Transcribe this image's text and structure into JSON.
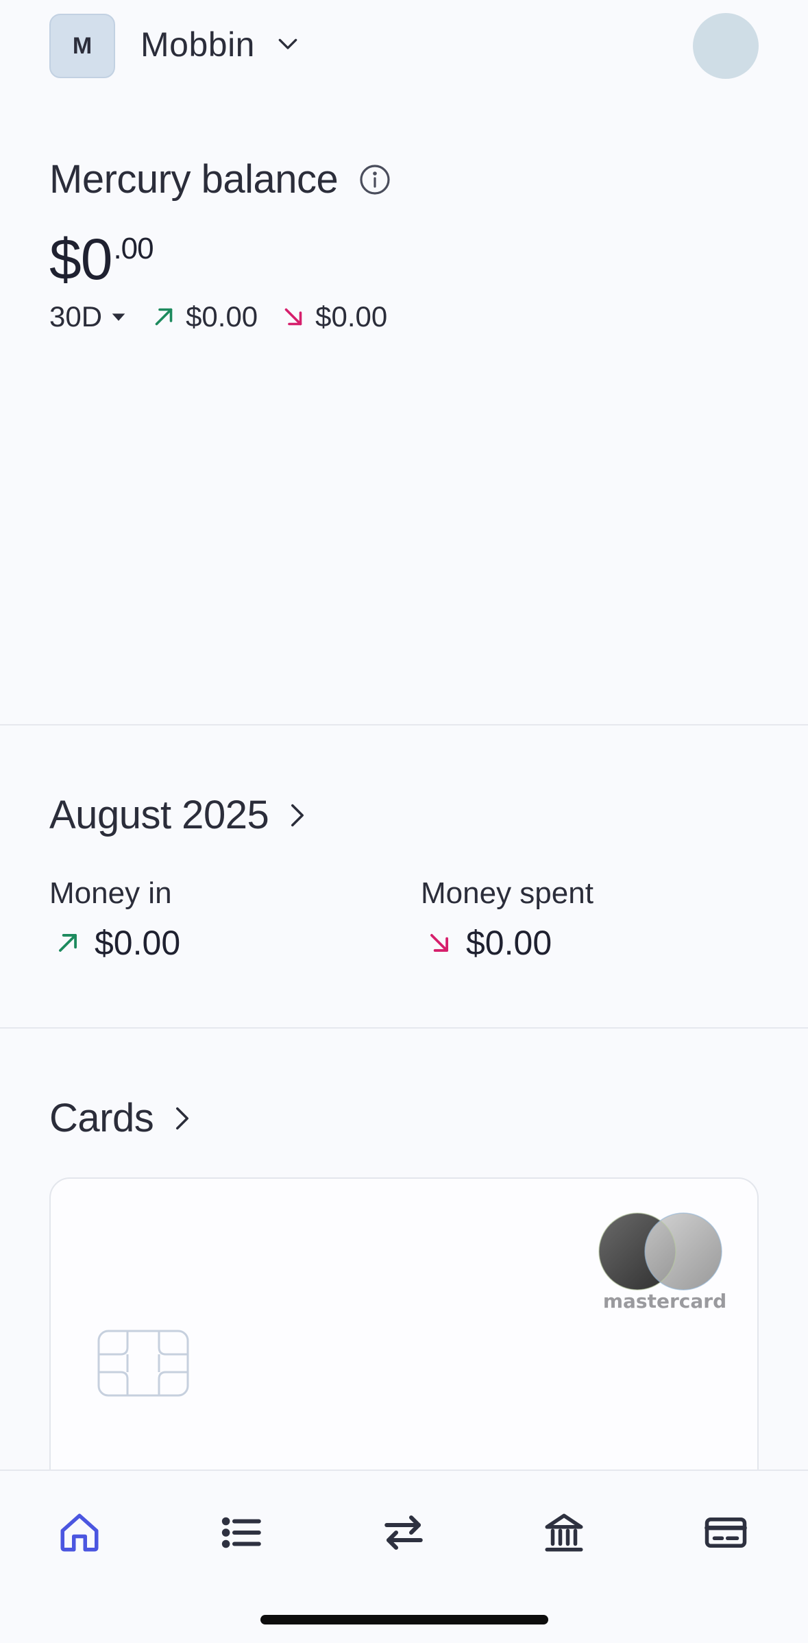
{
  "org": {
    "initial": "M",
    "name": "Mobbin"
  },
  "balance": {
    "title": "Mercury balance",
    "amount_main": "$0",
    "amount_cents": ".00",
    "period": "30D",
    "money_in": "$0.00",
    "money_out": "$0.00"
  },
  "month_summary": {
    "title": "August 2025",
    "money_in_label": "Money in",
    "money_in_value": "$0.00",
    "money_spent_label": "Money spent",
    "money_spent_value": "$0.00"
  },
  "cards": {
    "title": "Cards",
    "network": "mastercard"
  },
  "nav": {
    "items": [
      {
        "icon": "home-icon",
        "active": true
      },
      {
        "icon": "list-icon",
        "active": false
      },
      {
        "icon": "transfer-icon",
        "active": false
      },
      {
        "icon": "bank-icon",
        "active": false
      },
      {
        "icon": "card-icon",
        "active": false
      }
    ]
  },
  "colors": {
    "accent": "#4b56e0",
    "positive": "#1d8a5e",
    "negative": "#d61f6c",
    "background": "#f9fafd"
  }
}
